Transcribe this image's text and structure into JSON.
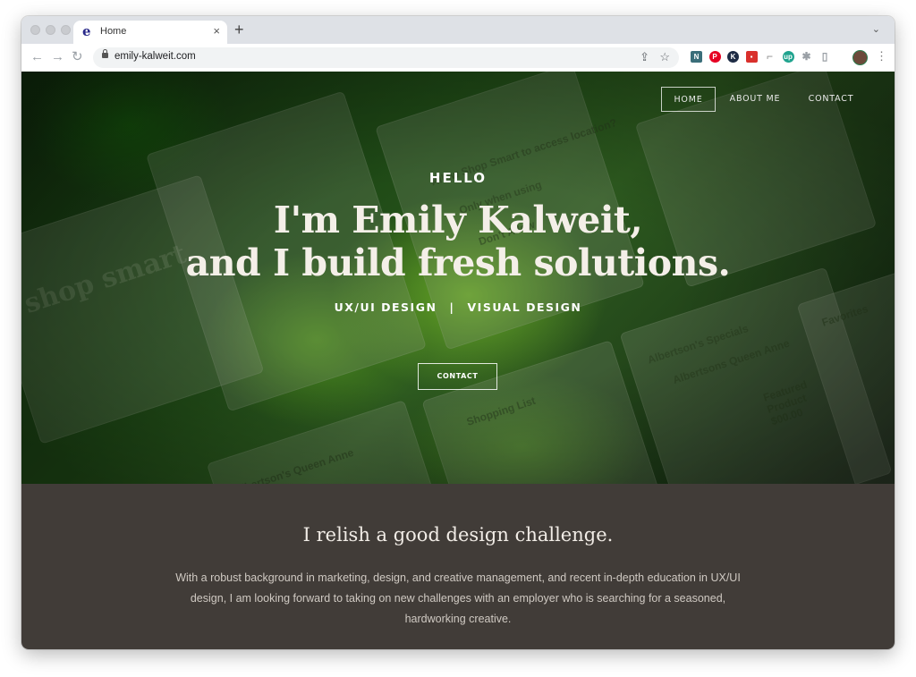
{
  "browser": {
    "tab": {
      "title": "Home",
      "favicon": "e-logo-icon",
      "close_label": "×"
    },
    "new_tab_label": "+",
    "tab_menu_label": "⌄",
    "url": "emily-kalweit.com",
    "nav": {
      "back": "←",
      "forward": "→",
      "reload": "↻"
    },
    "omnibox_icons": {
      "share": "⇪",
      "bookmark": "☆"
    },
    "extensions": [
      {
        "name": "news-extension-icon",
        "glyph": "N",
        "color": "#3a6e7a"
      },
      {
        "name": "pinterest-extension-icon",
        "glyph": "P",
        "color": "#e60023"
      },
      {
        "name": "k-extension-icon",
        "glyph": "K",
        "color": "#1d2b44"
      },
      {
        "name": "red-extension-icon",
        "glyph": "▪",
        "color": "#d9302c"
      },
      {
        "name": "arrows-extension-icon",
        "glyph": "⌐",
        "color": "#8a8a8a"
      },
      {
        "name": "up-extension-icon",
        "glyph": "up",
        "color": "#1fa38e"
      },
      {
        "name": "puzzle-extension-icon",
        "glyph": "✱",
        "color": "#9aa0a6"
      },
      {
        "name": "sidepanel-icon",
        "glyph": "▯",
        "color": "#9aa0a6"
      }
    ],
    "menu_label": "⋮"
  },
  "site": {
    "nav": [
      {
        "label": "HOME",
        "active": true
      },
      {
        "label": "ABOUT ME",
        "active": false
      },
      {
        "label": "CONTACT",
        "active": false
      }
    ],
    "hero": {
      "eyebrow": "HELLO",
      "headline_line1": "I'm Emily Kalweit,",
      "headline_line2": "and I build fresh solutions.",
      "tagline_left": "UX/UI DESIGN",
      "tagline_sep": "|",
      "tagline_right": "VISUAL DESIGN",
      "cta_label": "CONTACT",
      "background_snippets": [
        "shop smart",
        "Allow Shop Smart to access location?",
        "Only when using",
        "Don't Allow",
        "Albertson's Specials",
        "Albertsons Queen Anne",
        "Featured Product $00.00",
        "Shopping List",
        "Favorites",
        "Albertson's Queen Anne"
      ]
    },
    "about": {
      "title": "I relish a good design challenge.",
      "body": "With a robust background in marketing, design, and creative management, and recent in-depth education in UX/UI design, I am looking forward to taking on new challenges with an employer who is searching for a seasoned, hardworking creative."
    }
  },
  "colors": {
    "about_bg": "#413c38",
    "hero_green": "#2d5a1f",
    "tab_strip": "#dee1e6"
  }
}
